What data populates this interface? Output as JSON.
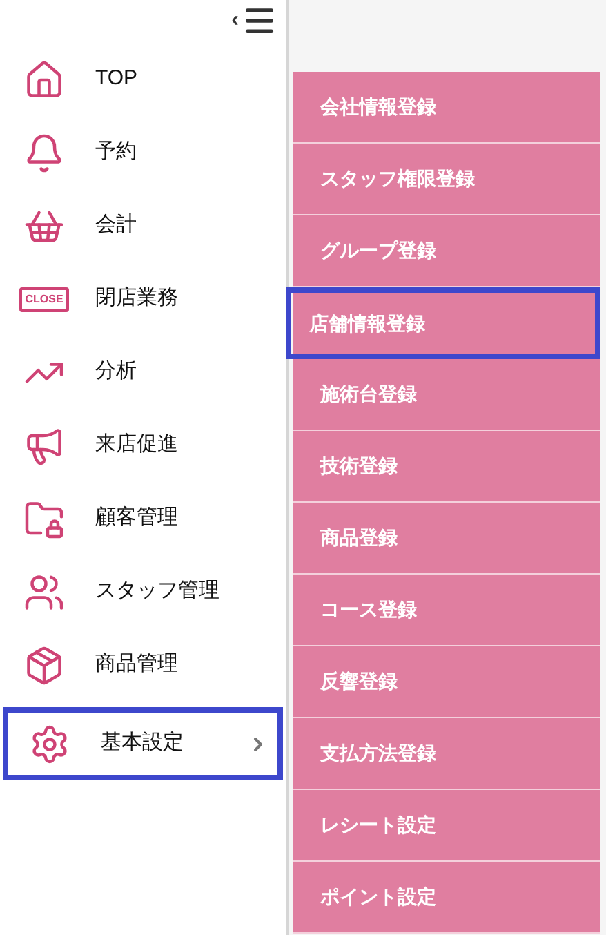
{
  "sidebar": {
    "collapse_arrow": "‹",
    "items": [
      {
        "label": "TOP",
        "selected": false,
        "has_submenu": false
      },
      {
        "label": "予約",
        "selected": false,
        "has_submenu": false
      },
      {
        "label": "会計",
        "selected": false,
        "has_submenu": false
      },
      {
        "label": "閉店業務",
        "selected": false,
        "has_submenu": false,
        "sign_text": "CLOSE"
      },
      {
        "label": "分析",
        "selected": false,
        "has_submenu": false
      },
      {
        "label": "来店促進",
        "selected": false,
        "has_submenu": false
      },
      {
        "label": "顧客管理",
        "selected": false,
        "has_submenu": false
      },
      {
        "label": "スタッフ管理",
        "selected": false,
        "has_submenu": false
      },
      {
        "label": "商品管理",
        "selected": false,
        "has_submenu": false
      },
      {
        "label": "基本設定",
        "selected": true,
        "has_submenu": true
      }
    ]
  },
  "submenu": {
    "items": [
      {
        "label": "会社情報登録",
        "selected": false
      },
      {
        "label": "スタッフ権限登録",
        "selected": false
      },
      {
        "label": "グループ登録",
        "selected": false
      },
      {
        "label": "店舗情報登録",
        "selected": true
      },
      {
        "label": "施術台登録",
        "selected": false
      },
      {
        "label": "技術登録",
        "selected": false
      },
      {
        "label": "商品登録",
        "selected": false
      },
      {
        "label": "コース登録",
        "selected": false
      },
      {
        "label": "反響登録",
        "selected": false
      },
      {
        "label": "支払方法登録",
        "selected": false
      },
      {
        "label": "レシート設定",
        "selected": false
      },
      {
        "label": "ポイント設定",
        "selected": false
      }
    ]
  }
}
